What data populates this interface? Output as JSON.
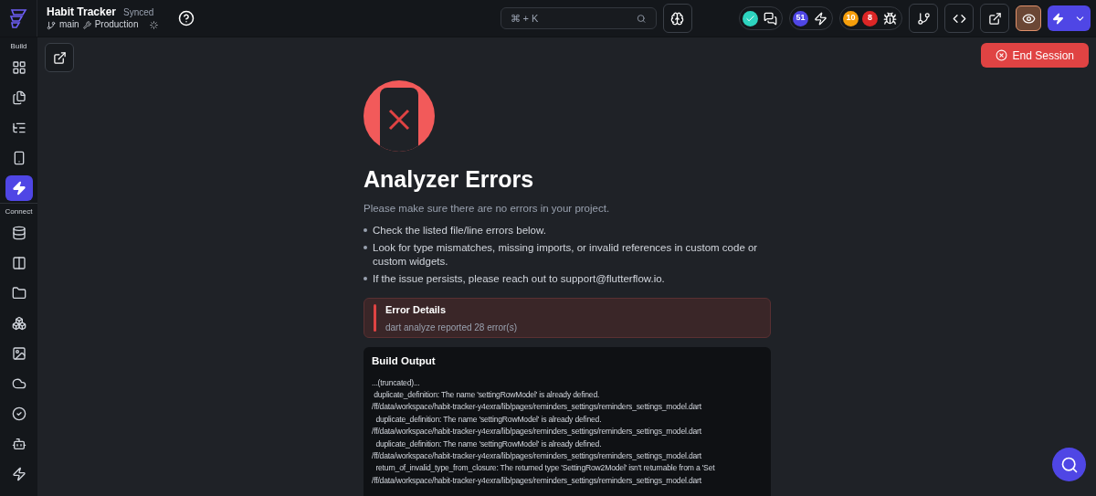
{
  "header": {
    "project": "Habit Tracker",
    "sync_status": "Synced",
    "branch": "main",
    "environment": "Production",
    "search": {
      "placeholder": "⌘ + K"
    },
    "badges": [
      {
        "text": "51",
        "color": "#4f46e5"
      },
      {
        "text": "10",
        "color": "#f59e0b"
      },
      {
        "text": "8",
        "color": "#dc2626"
      }
    ],
    "preview_on": true
  },
  "sidebar": [
    {
      "label": "Build",
      "items": [
        {
          "selected": false
        },
        {
          "selected": false
        },
        {
          "selected": false
        },
        {
          "selected": false
        },
        {
          "selected": true
        }
      ]
    },
    {
      "label": "Connect",
      "items": [
        {
          "selected": false
        },
        {
          "selected": false
        },
        {
          "selected": false
        },
        {
          "selected": false
        },
        {
          "selected": false
        },
        {
          "selected": false
        },
        {
          "selected": false
        },
        {
          "selected": false
        },
        {
          "selected": false
        }
      ]
    }
  ],
  "end_session": "End Session",
  "error": {
    "title": "Analyzer Errors",
    "subtitle": "Please make sure there are no errors in your project.",
    "tips": [
      "Check the listed file/line errors below.",
      "Look for type mismatches, missing imports, or invalid references in custom code or custom widgets.",
      "If the issue persists, please reach out to support@flutterflow.io."
    ],
    "details_title": "Error Details",
    "details_text": "dart analyze reported 28 error(s)",
    "output_title": "Build Output",
    "output_lines": [
      "...(truncated)...",
      " duplicate_definition: The name 'settingRowModel' is already defined.",
      "/ff/data/workspace/habit-tracker-y4exra/lib/pages/reminders_settings/reminders_settings_model.dart",
      "  duplicate_definition: The name 'settingRowModel' is already defined.",
      "/ff/data/workspace/habit-tracker-y4exra/lib/pages/reminders_settings/reminders_settings_model.dart",
      "  duplicate_definition: The name 'settingRowModel' is already defined.",
      "/ff/data/workspace/habit-tracker-y4exra/lib/pages/reminders_settings/reminders_settings_model.dart",
      "  return_of_invalid_type_from_closure: The returned type 'SettingRow2Model' isn't returnable from a 'Set",
      "/ff/data/workspace/habit-tracker-y4exra/lib/pages/reminders_settings/reminders_settings_model.dart"
    ]
  }
}
